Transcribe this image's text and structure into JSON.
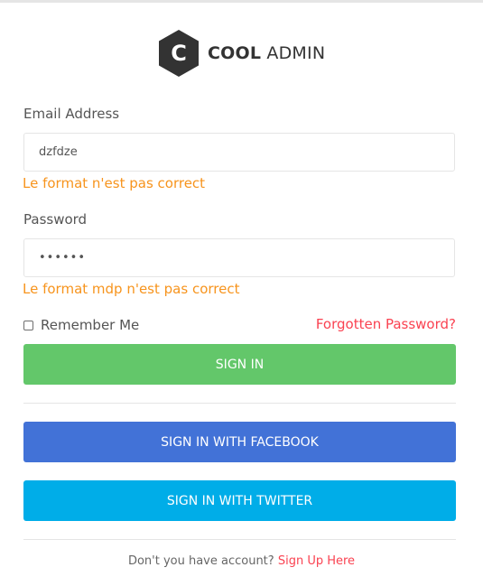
{
  "brand": {
    "logo_letter": "C",
    "name_bold": "COOL",
    "name_regular": "ADMIN"
  },
  "form": {
    "email_label": "Email Address",
    "email_value": "dzfdze",
    "email_error": "Le format n'est pas correct",
    "password_label": "Password",
    "password_value": "••••••",
    "password_error": "Le format mdp n'est pas correct",
    "remember_label": "Remember Me",
    "remember_checked": false,
    "forgot_label": "Forgotten Password?",
    "signin_label": "SIGN IN",
    "facebook_label": "SIGN IN WITH FACEBOOK",
    "twitter_label": "SIGN IN WITH TWITTER"
  },
  "footer": {
    "prompt": "Don't you have account?",
    "signup_label": "Sign Up Here"
  },
  "colors": {
    "error": "#f7941d",
    "link_red": "#fa4251",
    "signin_green": "#63c76a",
    "facebook_blue": "#4272d7",
    "twitter_blue": "#00ade8",
    "logo_dark": "#333333"
  },
  "icons": {
    "logo": "hexagon-logo-icon"
  }
}
